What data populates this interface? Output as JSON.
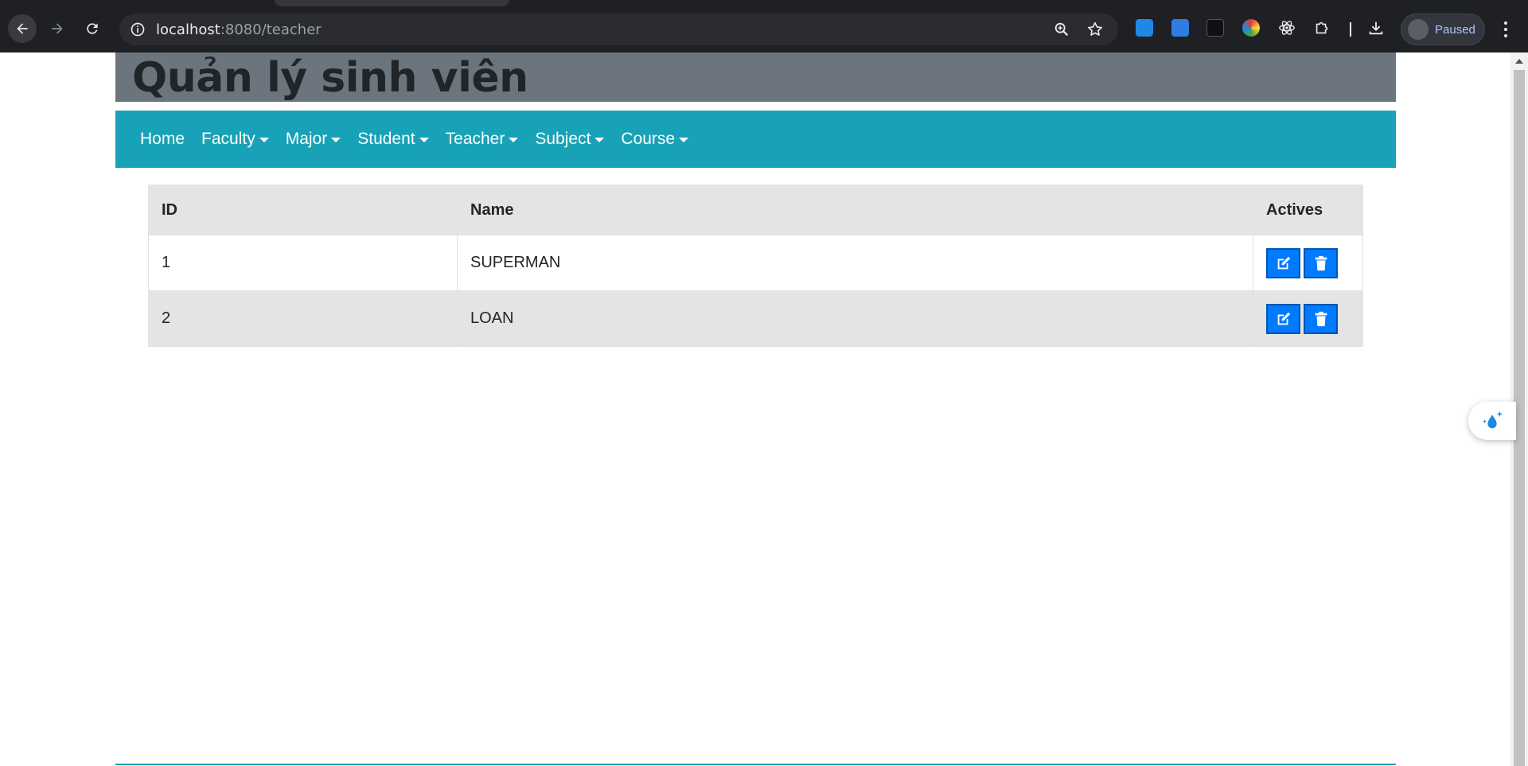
{
  "browser": {
    "url_host": "localhost",
    "url_path": ":8080/teacher",
    "profile_status": "Paused",
    "extensions": [
      "water-drop-icon",
      "docs-icon",
      "bolt-icon",
      "color-picker-icon",
      "react-icon",
      "puzzle-icon"
    ]
  },
  "page": {
    "title": "Quản lý sinh viên",
    "nav": {
      "home": "Home",
      "faculty": "Faculty",
      "major": "Major",
      "student": "Student",
      "teacher": "Teacher",
      "subject": "Subject",
      "course": "Course"
    },
    "table": {
      "headers": {
        "id": "ID",
        "name": "Name",
        "actions": "Actives"
      },
      "rows": [
        {
          "id": "1",
          "name": "SUPERMAN"
        },
        {
          "id": "2",
          "name": "LOAN"
        }
      ]
    }
  },
  "colors": {
    "header_bg": "#6c757d",
    "navbar_bg": "#17a2b8",
    "button_bg": "#007bff",
    "row_alt_bg": "#e4e4e4"
  }
}
